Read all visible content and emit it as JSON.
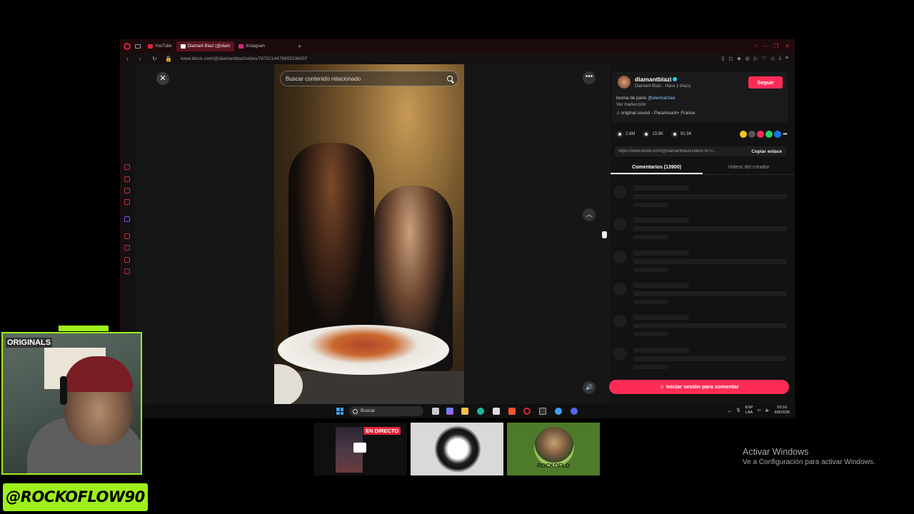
{
  "browser": {
    "tabs": [
      {
        "label": "YouTube",
        "active": false,
        "color": "#e0243a"
      },
      {
        "label": "Diamant Blazi (@diam",
        "active": true,
        "color": "#ffffff"
      },
      {
        "label": "Instagram",
        "active": false,
        "color": "#d62976"
      }
    ],
    "new_tab": "+",
    "url": "www.tiktok.com/@diamantblazi/video/7670214478905336097",
    "accent": "#e0243a"
  },
  "viewer": {
    "close": "✕",
    "search_placeholder": "Buscar contenido relacionado",
    "more": "•••",
    "up": "︿",
    "volume": "🔊"
  },
  "panel": {
    "username": "diamantblazi",
    "subtitle": "Diamant Blazi · Hace 1 día(s)",
    "follow": "Seguir",
    "desc_text": "lesma de paris ",
    "desc_mention": "@alencarzao",
    "translate": "Ver traducción",
    "sound": "♫  original sound - Paramount+ France",
    "likes": "2.6M",
    "comments": "13.9K",
    "saves": "91.5K",
    "share_colors": [
      "#f5c518",
      "#555555",
      "#fe2c55",
      "#25d366",
      "#1877f2"
    ],
    "link": "https://www.tiktok.com/@diamantblazi/video/7670...",
    "copy_link": "Copiar enlace",
    "tab_comments": "Comentarios (13900)",
    "tab_videos": "Videos del creador",
    "login": "Iniciar sesión para comentar",
    "accent": "#fe2c55"
  },
  "taskbar": {
    "search": "Buscar",
    "lang_top": "ESP",
    "lang_bottom": "LAA",
    "time": "03:16",
    "date": "6/8/2026"
  },
  "stream": {
    "webcam_label": "ORIGINALS",
    "banner": "@ROCKOFLOW90",
    "live_badge": "EN DIRECTO",
    "thumb3_name": "ROCKOFLO",
    "accent": "#9ef01a"
  },
  "windows": {
    "activate_title": "Activar Windows",
    "activate_sub": "Ve a Configuración para activar Windows."
  }
}
